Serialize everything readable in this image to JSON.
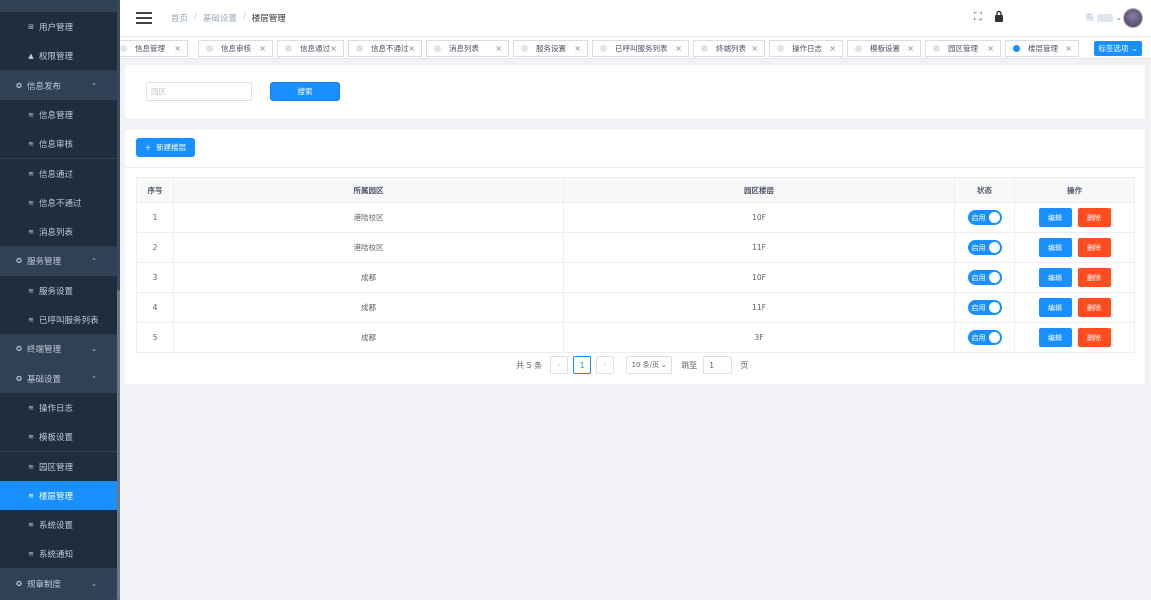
{
  "sidebar": {
    "items": [
      {
        "label": "用户管理",
        "icon": "users-icon",
        "type": "sub"
      },
      {
        "label": "权限管理",
        "icon": "warning-icon",
        "type": "sub"
      },
      {
        "label": "信息发布",
        "icon": "globe-icon",
        "type": "group",
        "arrow": "up"
      },
      {
        "label": "信息管理",
        "icon": "layers-icon",
        "type": "sub"
      },
      {
        "label": "信息审核",
        "icon": "layers-icon",
        "type": "sub"
      },
      {
        "label": "信息通过",
        "icon": "layers-icon",
        "type": "sub"
      },
      {
        "label": "信息不通过",
        "icon": "layers-icon",
        "type": "sub"
      },
      {
        "label": "消息列表",
        "icon": "layers-icon",
        "type": "sub"
      },
      {
        "label": "服务管理",
        "icon": "globe-icon",
        "type": "group",
        "arrow": "up"
      },
      {
        "label": "服务设置",
        "icon": "layers-icon",
        "type": "sub"
      },
      {
        "label": "已呼叫服务列表",
        "icon": "layers-icon",
        "type": "sub"
      },
      {
        "label": "终端管理",
        "icon": "globe-icon",
        "type": "group",
        "arrow": "down"
      },
      {
        "label": "基础设置",
        "icon": "globe-icon",
        "type": "group",
        "arrow": "up"
      },
      {
        "label": "操作日志",
        "icon": "layers-icon",
        "type": "sub"
      },
      {
        "label": "模板设置",
        "icon": "layers-icon",
        "type": "sub"
      },
      {
        "label": "园区管理",
        "icon": "layers-icon",
        "type": "sub"
      },
      {
        "label": "楼层管理",
        "icon": "layers-icon",
        "type": "sub",
        "active": true
      },
      {
        "label": "系统设置",
        "icon": "layers-icon",
        "type": "sub"
      },
      {
        "label": "系统通知",
        "icon": "layers-icon",
        "type": "sub"
      },
      {
        "label": "规章制度",
        "icon": "globe-icon",
        "type": "group",
        "arrow": "down"
      }
    ]
  },
  "header": {
    "breadcrumb": [
      "首页",
      "基础设置",
      "楼层管理"
    ],
    "user_name": "陈"
  },
  "tabs": [
    {
      "label": "信息管理"
    },
    {
      "label": "信息审核"
    },
    {
      "label": "信息通过"
    },
    {
      "label": "信息不通过"
    },
    {
      "label": "消息列表"
    },
    {
      "label": "服务设置"
    },
    {
      "label": "已呼叫服务列表"
    },
    {
      "label": "终端列表"
    },
    {
      "label": "操作日志"
    },
    {
      "label": "模板设置"
    },
    {
      "label": "园区管理"
    },
    {
      "label": "楼层管理",
      "active": true
    }
  ],
  "tab_menu_label": "标签选项",
  "search": {
    "placeholder": "园区",
    "button_label": "搜索"
  },
  "toolbar": {
    "new_label": "新建楼层",
    "new_icon": "+"
  },
  "table": {
    "headers": [
      "序号",
      "所属园区",
      "园区楼层",
      "状态",
      "操作"
    ],
    "rows": [
      {
        "index": "1",
        "park": "港陆校区",
        "floor": "10F",
        "status": "启用"
      },
      {
        "index": "2",
        "park": "港陆校区",
        "floor": "11F",
        "status": "启用"
      },
      {
        "index": "3",
        "park": "成都",
        "floor": "10F",
        "status": "启用"
      },
      {
        "index": "4",
        "park": "成都",
        "floor": "11F",
        "status": "启用"
      },
      {
        "index": "5",
        "park": "成都",
        "floor": "3F",
        "status": "启用"
      }
    ],
    "edit_label": "编辑",
    "delete_label": "删除"
  },
  "pager": {
    "total_text": "共 5 条",
    "current_page": "1",
    "page_size": "10 条/页",
    "jump_label": "跳至",
    "jump_value": "1",
    "page_label": "页"
  },
  "colors": {
    "accent": "#1890ff",
    "danger": "#ff4d1f",
    "sidebar_bg": "#304156",
    "sidebar_sub_bg": "#1f2d3d"
  }
}
